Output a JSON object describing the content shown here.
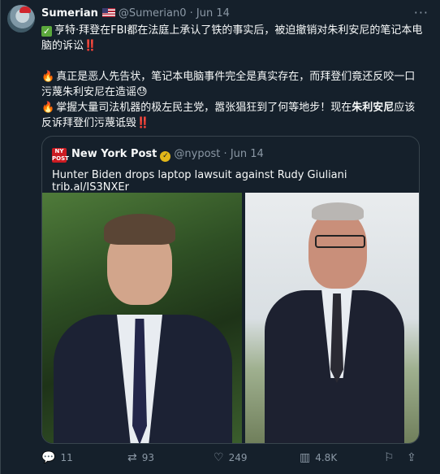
{
  "tweet": {
    "author_name": "Sumerian",
    "author_handle": "@Sumerian0",
    "separator": "·",
    "date": "Jun 14",
    "more_icon": "more-dots-icon",
    "line1_text": "亨特·拜登在FBI都在法庭上承认了铁的事实后，被迫撤销对朱利安尼的笔记本电脑的诉讼",
    "line2_text": "真正是恶人先告状，笔记本电脑事件完全是真实存在，而拜登们竟还反咬一口污蔑朱利安尼在造谣",
    "line3_prefix": "掌握大量司法机器的极左民主党，嚣张猖狂到了何等地步！现在",
    "line3_bold": "朱利安尼",
    "line3_suffix": "应该反诉拜登们污蔑诋毁",
    "bang": "‼️",
    "sweat_emoji": "😓"
  },
  "quote": {
    "logo_text": "NEW YORK POST",
    "name": "New York Post",
    "handle": "@nypost",
    "separator": "·",
    "date": "Jun 14",
    "text": "Hunter Biden drops laptop lawsuit against Rudy Giuliani trib.al/IS3NXEr"
  },
  "actions": {
    "replies": "11",
    "retweets": "93",
    "likes": "249",
    "views": "4.8K"
  },
  "colors": {
    "background": "#15202b",
    "secondary_text": "#8b98a5",
    "border": "#38444d",
    "verified_gold": "#e2b719",
    "nyp_red": "#cc1b22"
  }
}
